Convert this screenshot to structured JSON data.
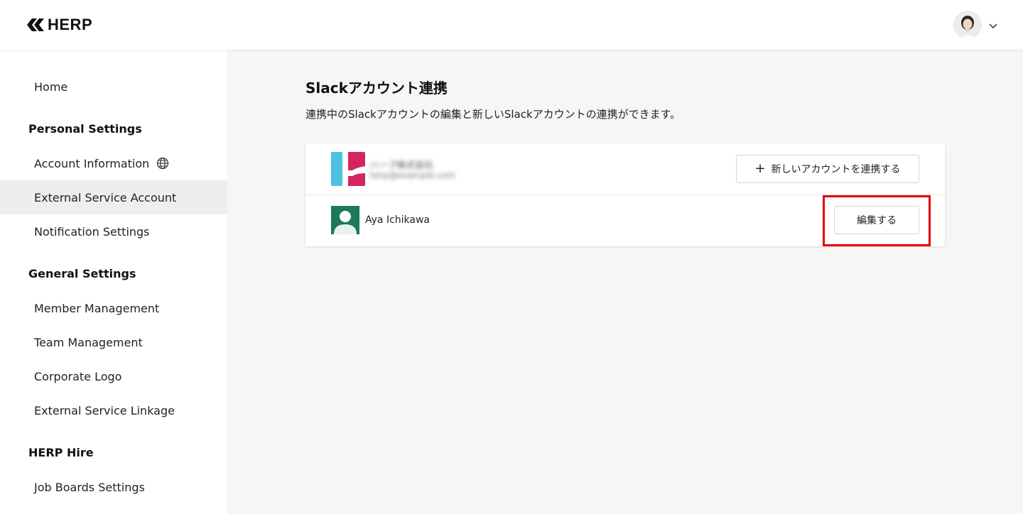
{
  "header": {
    "logo_text": "HERP",
    "logo_icon": "herp-logo-icon",
    "user_avatar_icon": "user-avatar-photo",
    "menu_icon": "chevron-down-icon"
  },
  "sidebar": {
    "home": "Home",
    "personal_heading": "Personal Settings",
    "personal_items": [
      "Account Information",
      "External Service Account",
      "Notification Settings"
    ],
    "account_icon": "globe-icon",
    "general_heading": "General Settings",
    "general_items": [
      "Member Management",
      "Team Management",
      "Corporate Logo",
      "External Service Linkage"
    ],
    "hire_heading": "HERP Hire",
    "hire_items": [
      "Job Boards Settings"
    ],
    "active_item": "External Service Account"
  },
  "main": {
    "title": "Slackアカウント連携",
    "description": "連携中のSlackアカウントの編集と新しいSlackアカウントの連携ができます。",
    "workspace": {
      "name": "ハーブ株式会社",
      "email": "herp@example.com",
      "colors": [
        "#4ec1e0",
        "#d6245e"
      ]
    },
    "add_button": "新しいアカウントを連携する",
    "add_icon": "plus-icon",
    "account": {
      "name": "Aya Ichikawa",
      "avatar_color": "#1a7a5a",
      "edit_button": "編集する"
    },
    "highlight_color": "#e00000"
  }
}
